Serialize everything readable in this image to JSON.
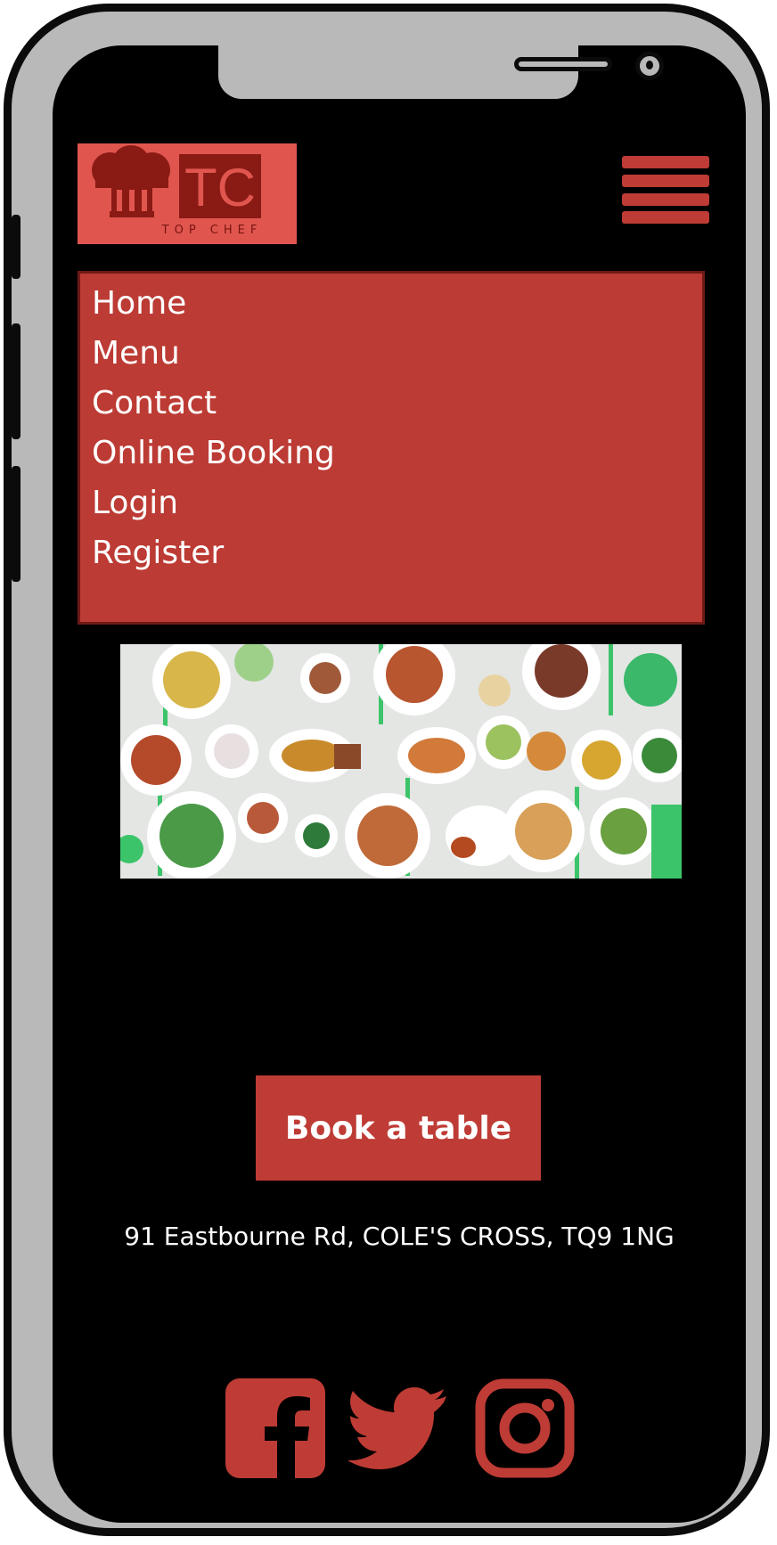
{
  "header": {
    "logo": {
      "monogram": "TC",
      "tagline": "TOP CHEF",
      "icon": "chef-hat-icon"
    },
    "menu_toggle_icon": "hamburger-icon"
  },
  "nav": {
    "items": [
      {
        "label": "Home"
      },
      {
        "label": "Menu"
      },
      {
        "label": "Contact"
      },
      {
        "label": "Online Booking"
      },
      {
        "label": "Login"
      },
      {
        "label": "Register"
      }
    ]
  },
  "hero": {
    "image": "food-spread-image"
  },
  "cta": {
    "book_label": "Book a table"
  },
  "footer": {
    "address": "91 Eastbourne Rd, COLE'S CROSS, TQ9 1NG",
    "social": [
      {
        "icon": "facebook-icon"
      },
      {
        "icon": "twitter-icon"
      },
      {
        "icon": "instagram-icon"
      }
    ]
  },
  "colors": {
    "accent": "#be3c35",
    "logo_bg": "#e0564f",
    "logo_dark": "#8a1a14",
    "background": "#000000",
    "text": "#ffffff",
    "frame": "#b9b9b9"
  }
}
